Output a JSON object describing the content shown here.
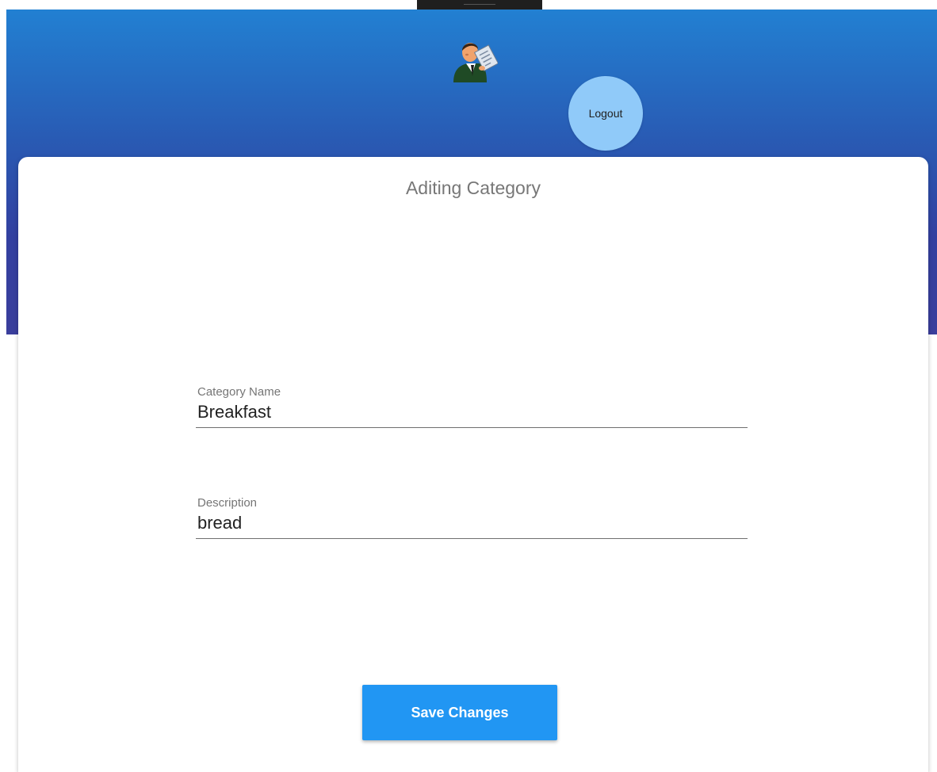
{
  "header": {
    "logout_label": "Logout",
    "avatar_icon": "businessman-with-checklist-icon"
  },
  "form": {
    "title": "Aditing Category",
    "category_name": {
      "label": "Category Name",
      "value": "Breakfast"
    },
    "description": {
      "label": "Description",
      "value": "bread"
    },
    "save_label": "Save Changes"
  },
  "colors": {
    "header_gradient_top": "#2280d2",
    "header_gradient_bottom": "#3a3e9c",
    "logout_button": "#90caf9",
    "save_button": "#2196f3"
  }
}
